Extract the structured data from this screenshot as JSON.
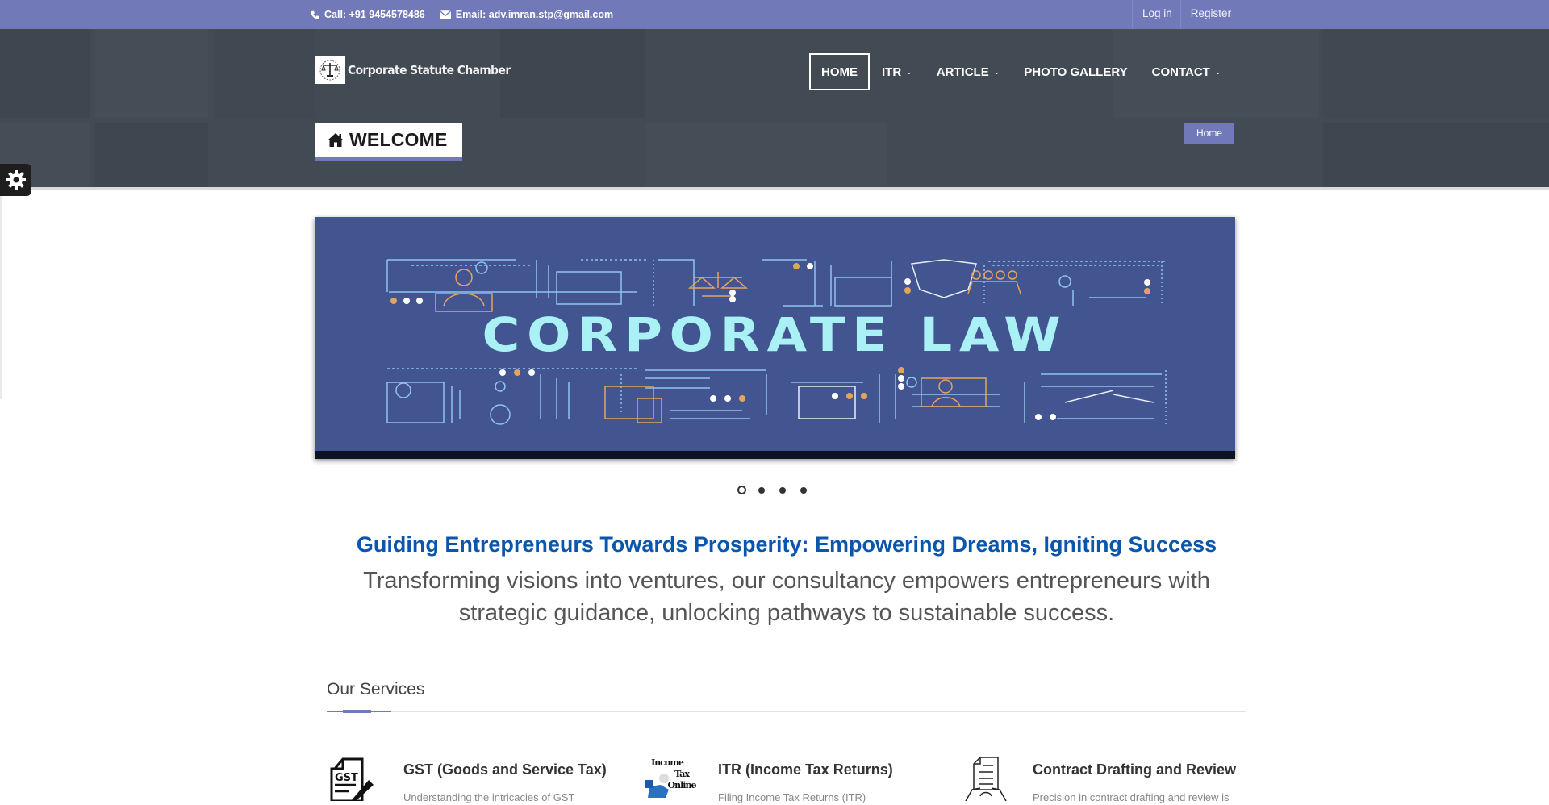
{
  "topbar": {
    "phone": "Call: +91 9454578486",
    "email": "Email: adv.imran.stp@gmail.com",
    "login": "Log in",
    "register": "Register",
    "bg_color": "#7279b8"
  },
  "header": {
    "site_name": "Corporate Statute Chamber",
    "nav": [
      {
        "label": "HOME",
        "active": true,
        "has_dropdown": false
      },
      {
        "label": "ITR",
        "active": false,
        "has_dropdown": true
      },
      {
        "label": "ARTICLE",
        "active": false,
        "has_dropdown": true
      },
      {
        "label": "PHOTO GALLERY",
        "active": false,
        "has_dropdown": false
      },
      {
        "label": "CONTACT",
        "active": false,
        "has_dropdown": true
      }
    ],
    "page_title": "WELCOME",
    "breadcrumb": "Home"
  },
  "slider": {
    "slide_text": "CORPORATE LAW",
    "total_slides": 4,
    "active_slide": 1
  },
  "intro": {
    "tagline": "Guiding Entrepreneurs Towards Prosperity: Empowering Dreams, Igniting Success",
    "subtext": "Transforming visions into ventures, our consultancy empowers entrepreneurs with strategic guidance, unlocking pathways to sustainable success."
  },
  "services": {
    "heading": "Our Services",
    "items": [
      {
        "icon": "gst-document-icon",
        "title": "GST (Goods and Service Tax)",
        "desc": "Understanding the intricacies of GST"
      },
      {
        "icon": "income-tax-online-icon",
        "title": "ITR (Income Tax Returns)",
        "desc": "Filing Income Tax Returns (ITR)"
      },
      {
        "icon": "contract-document-icon",
        "title": "Contract Drafting and Review",
        "desc": "Precision in contract drafting and review is"
      }
    ]
  },
  "colors": {
    "accent": "#7279b8",
    "tagline": "#0a56ad",
    "slide_bg": "#435591"
  }
}
